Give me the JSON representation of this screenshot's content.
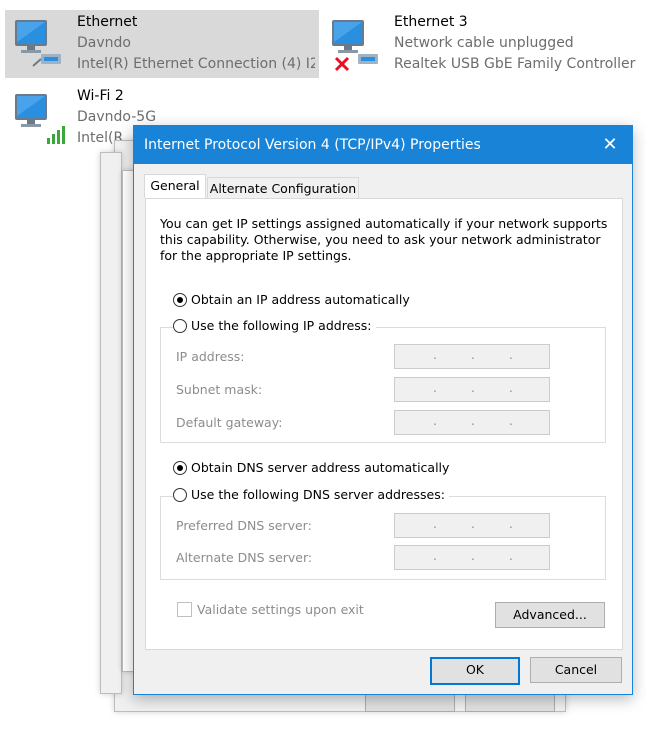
{
  "adapters": [
    {
      "name": "Ethernet",
      "status": "Davndo",
      "device": "Intel(R) Ethernet Connection (4) I2...",
      "icon": "ethernet-adapter-icon",
      "selected": true
    },
    {
      "name": "Ethernet 3",
      "status": "Network cable unplugged",
      "device": "Realtek USB GbE Family Controller",
      "icon": "ethernet-adapter-unplugged-icon",
      "selected": false
    },
    {
      "name": "Wi-Fi 2",
      "status": "Davndo-5G",
      "device": "Intel(R",
      "icon": "wifi-adapter-icon",
      "selected": false
    }
  ],
  "dialog": {
    "title": "Internet Protocol Version 4 (TCP/IPv4) Properties",
    "close_icon": "close-icon",
    "tabs": [
      {
        "label": "General",
        "active": true
      },
      {
        "label": "Alternate Configuration",
        "active": false
      }
    ],
    "intro": "You can get IP settings assigned automatically if your network supports this capability. Otherwise, you need to ask your network administrator for the appropriate IP settings.",
    "ip": {
      "auto_label": "Obtain an IP address automatically",
      "manual_label": "Use the following IP address:",
      "selected": "auto",
      "fields": [
        {
          "label": "IP address:",
          "value": ". . ."
        },
        {
          "label": "Subnet mask:",
          "value": ". . ."
        },
        {
          "label": "Default gateway:",
          "value": ". . ."
        }
      ]
    },
    "dns": {
      "auto_label": "Obtain DNS server address automatically",
      "manual_label": "Use the following DNS server addresses:",
      "selected": "auto",
      "fields": [
        {
          "label": "Preferred DNS server:",
          "value": ". . ."
        },
        {
          "label": "Alternate DNS server:",
          "value": ". . ."
        }
      ]
    },
    "validate_label": "Validate settings upon exit",
    "validate_checked": false,
    "advanced_label": "Advanced...",
    "ok_label": "OK",
    "cancel_label": "Cancel"
  },
  "colors": {
    "accent": "#1883d7",
    "selected_tile": "#d9d9d9",
    "disabled_text": "#8c8c8c",
    "dialog_bg": "#f0f0f0"
  }
}
